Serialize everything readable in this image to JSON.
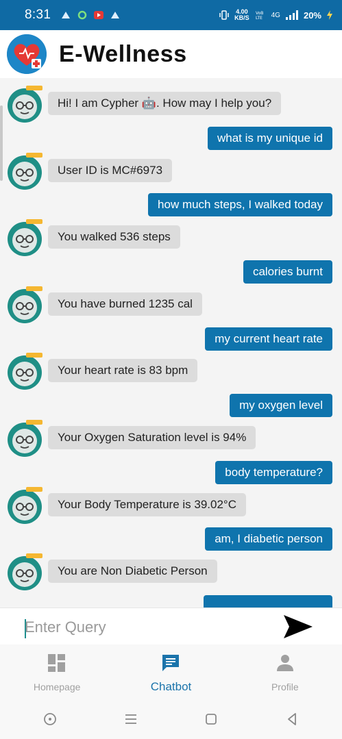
{
  "status_bar": {
    "time": "8:31",
    "speed_value": "4.00",
    "speed_unit": "KB/S",
    "network": "4G",
    "battery": "20%"
  },
  "app": {
    "title": "E-Wellness"
  },
  "chat": {
    "messages": [
      {
        "from": "bot",
        "text": "Hi! I am Cypher 🤖. How may I help you?"
      },
      {
        "from": "user",
        "text": "what is my unique id"
      },
      {
        "from": "bot",
        "text": "User ID is MC#6973"
      },
      {
        "from": "user",
        "text": "how much steps, I walked today"
      },
      {
        "from": "bot",
        "text": "You walked 536 steps"
      },
      {
        "from": "user",
        "text": "calories burnt"
      },
      {
        "from": "bot",
        "text": "You have burned 1235 cal"
      },
      {
        "from": "user",
        "text": "my current heart rate"
      },
      {
        "from": "bot",
        "text": "Your heart rate is 83 bpm"
      },
      {
        "from": "user",
        "text": "my oxygen level"
      },
      {
        "from": "bot",
        "text": "Your Oxygen Saturation level is 94%"
      },
      {
        "from": "user",
        "text": "body temperature?"
      },
      {
        "from": "bot",
        "text": "Your Body Temperature is 39.02°C"
      },
      {
        "from": "user",
        "text": "am, I diabetic person"
      },
      {
        "from": "bot",
        "text": "You are Non Diabetic Person"
      }
    ]
  },
  "input": {
    "placeholder": "Enter Query",
    "value": ""
  },
  "bottom_nav": {
    "items": [
      {
        "label": "Homepage",
        "icon": "dashboard-icon",
        "active": false
      },
      {
        "label": "Chatbot",
        "icon": "chat-icon",
        "active": true
      },
      {
        "label": "Profile",
        "icon": "person-icon",
        "active": false
      }
    ]
  },
  "colors": {
    "accent": "#0f74ad",
    "bot_bubble": "#dcdcdc",
    "active_nav": "#1b74ab",
    "inactive_nav": "#a0a0a0"
  }
}
